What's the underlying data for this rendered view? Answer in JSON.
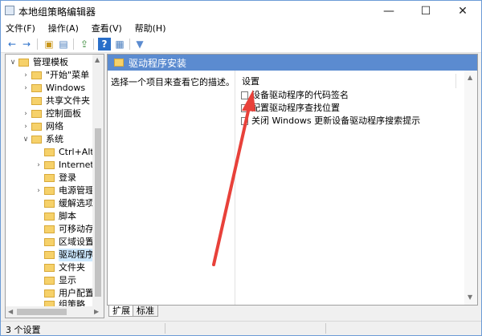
{
  "window": {
    "title": "本地组策略编辑器",
    "minimize": "—",
    "maximize": "☐",
    "close": "✕"
  },
  "menu": [
    "文件(F)",
    "操作(A)",
    "查看(V)",
    "帮助(H)"
  ],
  "toolbar": {
    "back": "←",
    "forward": "→",
    "up": "▣",
    "view": "▤",
    "export": "⇪",
    "help": "?",
    "properties": "▦",
    "filter": "▼"
  },
  "tree": {
    "items": [
      {
        "label": "管理模板",
        "arrow": "∨"
      },
      {
        "label": "\"开始\"菜单",
        "arrow": "›"
      },
      {
        "label": "Windows",
        "arrow": "›"
      },
      {
        "label": "共享文件夹",
        "arrow": ""
      },
      {
        "label": "控制面板",
        "arrow": "›"
      },
      {
        "label": "网络",
        "arrow": "›"
      },
      {
        "label": "系统",
        "arrow": "∨"
      },
      {
        "label": "Ctrl+Alt",
        "arrow": ""
      },
      {
        "label": "Internet",
        "arrow": "›"
      },
      {
        "label": "登录",
        "arrow": ""
      },
      {
        "label": "电源管理",
        "arrow": "›"
      },
      {
        "label": "缓解选项",
        "arrow": ""
      },
      {
        "label": "脚本",
        "arrow": ""
      },
      {
        "label": "可移动存储",
        "arrow": ""
      },
      {
        "label": "区域设置",
        "arrow": ""
      },
      {
        "label": "驱动程序",
        "arrow": ""
      },
      {
        "label": "文件夹",
        "arrow": ""
      },
      {
        "label": "显示",
        "arrow": ""
      },
      {
        "label": "用户配置",
        "arrow": ""
      },
      {
        "label": "组策略",
        "arrow": ""
      }
    ]
  },
  "content": {
    "header": "驱动程序安装",
    "description": "选择一个项目来查看它的描述。",
    "column": "设置",
    "settings": [
      "设备驱动程序的代码签名",
      "配置驱动程序查找位置",
      "关闭 Windows 更新设备驱动程序搜索提示"
    ]
  },
  "tabs": [
    "扩展",
    "标准"
  ],
  "status": {
    "text": "3 个设置"
  },
  "colors": {
    "accent": "#5b8bd0",
    "arrow": "#e8413a"
  }
}
